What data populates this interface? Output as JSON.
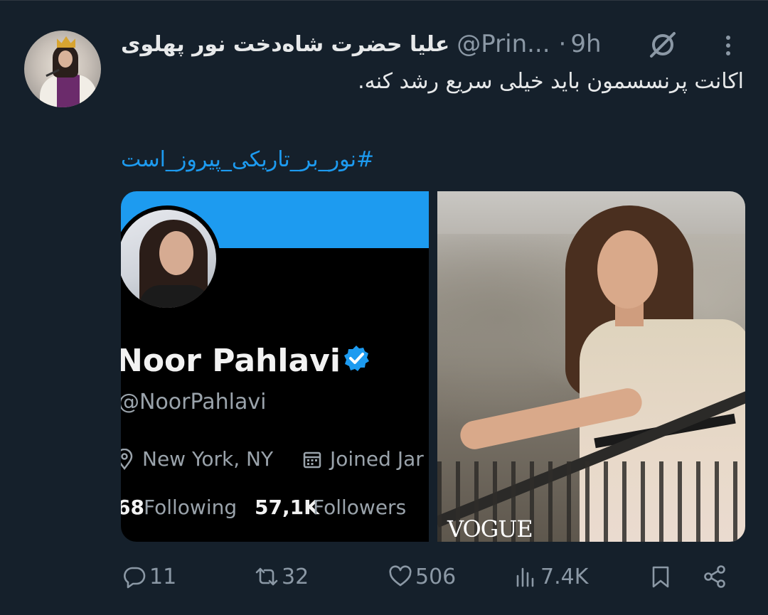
{
  "tweet": {
    "display_name": "علیا حضرت شاه‌دخت نور پهلوی",
    "handle": "@Prin...",
    "separator": "·",
    "time": "9h",
    "text": "اکانت پرنسسمون باید خیلی سریع رشد کنه.",
    "hashtag": "#نور_بر_تاریکی_پیروز_است"
  },
  "media": {
    "profile_card": {
      "name": "Noor Pahlavi",
      "handle": "@NoorPahlavi",
      "location": "New York, NY",
      "joined": "Joined Jar",
      "following_count": "68",
      "following_label": "Following",
      "followers_count": "57,1K",
      "followers_label": "Followers",
      "banner_color": "#1d9bf0"
    },
    "photo_logo": "VOGUE"
  },
  "actions": {
    "replies": "11",
    "reposts": "32",
    "likes": "506",
    "views": "7.4K"
  },
  "icons": [
    "grok-icon",
    "more-icon",
    "verified-icon",
    "location-icon",
    "calendar-icon",
    "reply-icon",
    "repost-icon",
    "like-icon",
    "views-icon",
    "bookmark-icon",
    "share-icon"
  ],
  "colors": {
    "background": "#15202b",
    "accent": "#1d9bf0",
    "muted": "#8b98a5",
    "text": "#e7e9ea"
  }
}
